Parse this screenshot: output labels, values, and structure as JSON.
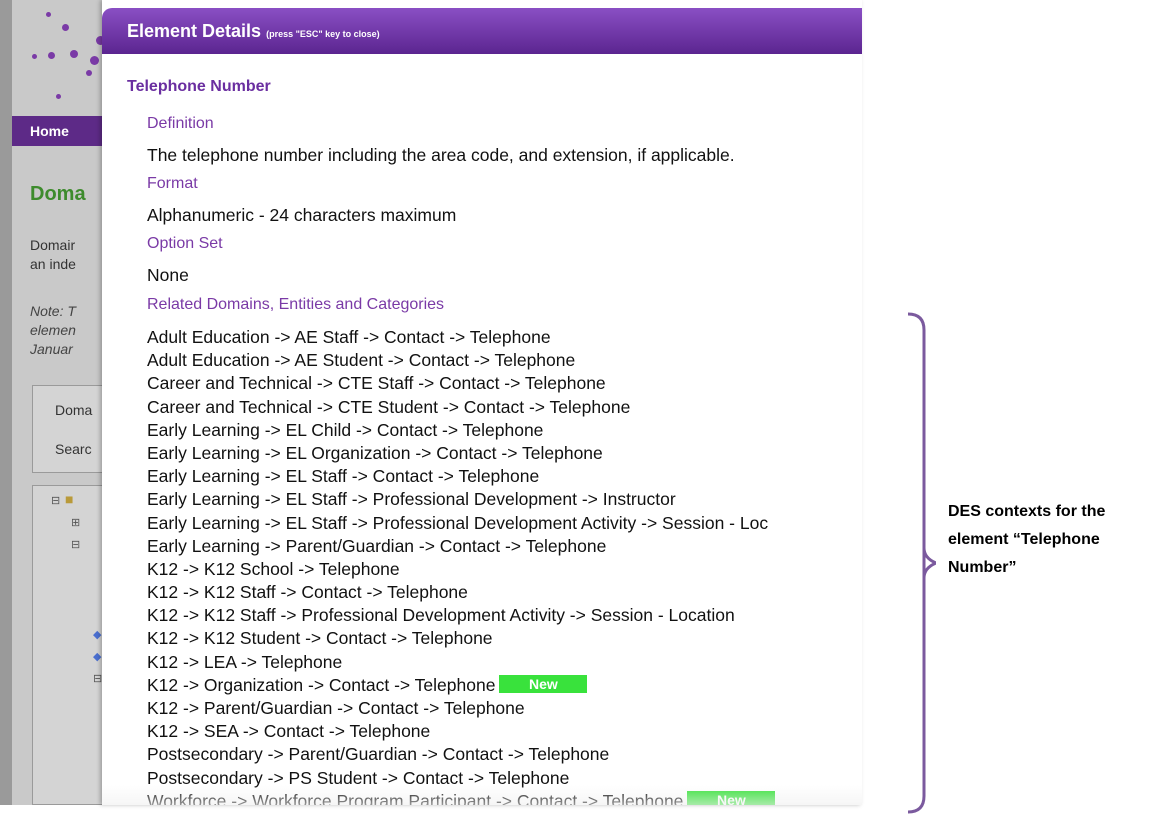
{
  "background": {
    "nav_home": "Home",
    "domain_title": "Doma",
    "text_line1": "Domair",
    "text_line2": "an inde",
    "note_line1": "Note: T",
    "note_line2": "elemen",
    "note_line3": "Januar",
    "box_line1": "Doma",
    "box_line2": "Searc"
  },
  "modal": {
    "title": "Element Details",
    "title_hint": "(press \"ESC\" key to close)",
    "element_name": "Telephone Number",
    "definition_label": "Definition",
    "definition_value": "The telephone number including the area code, and extension, if applicable.",
    "format_label": "Format",
    "format_value": "Alphanumeric - 24 characters maximum",
    "option_set_label": "Option Set",
    "option_set_value": "None",
    "related_label": "Related Domains, Entities and Categories",
    "related": [
      {
        "text": "Adult Education -> AE Staff -> Contact -> Telephone",
        "badge": ""
      },
      {
        "text": "Adult Education -> AE Student -> Contact -> Telephone",
        "badge": ""
      },
      {
        "text": "Career and Technical -> CTE Staff -> Contact -> Telephone",
        "badge": ""
      },
      {
        "text": "Career and Technical -> CTE Student -> Contact -> Telephone",
        "badge": ""
      },
      {
        "text": "Early Learning -> EL Child -> Contact -> Telephone",
        "badge": ""
      },
      {
        "text": "Early Learning -> EL Organization -> Contact -> Telephone",
        "badge": ""
      },
      {
        "text": "Early Learning -> EL Staff -> Contact -> Telephone",
        "badge": ""
      },
      {
        "text": "Early Learning -> EL Staff -> Professional Development -> Instructor",
        "badge": ""
      },
      {
        "text": "Early Learning -> EL Staff -> Professional Development Activity -> Session - Loc",
        "badge": ""
      },
      {
        "text": "Early Learning -> Parent/Guardian -> Contact -> Telephone",
        "badge": ""
      },
      {
        "text": "K12 -> K12 School -> Telephone",
        "badge": ""
      },
      {
        "text": "K12 -> K12 Staff -> Contact -> Telephone",
        "badge": ""
      },
      {
        "text": "K12 -> K12 Staff -> Professional Development Activity -> Session - Location",
        "badge": ""
      },
      {
        "text": "K12 -> K12 Student -> Contact -> Telephone",
        "badge": ""
      },
      {
        "text": "K12 -> LEA -> Telephone",
        "badge": ""
      },
      {
        "text": "K12 -> Organization -> Contact -> Telephone",
        "badge": "New"
      },
      {
        "text": "K12 -> Parent/Guardian -> Contact -> Telephone",
        "badge": ""
      },
      {
        "text": "K12 -> SEA -> Contact -> Telephone",
        "badge": ""
      },
      {
        "text": "Postsecondary -> Parent/Guardian -> Contact -> Telephone",
        "badge": ""
      },
      {
        "text": "Postsecondary -> PS Student -> Contact -> Telephone",
        "badge": ""
      },
      {
        "text": "Workforce -> Workforce Program Participant -> Contact -> Telephone",
        "badge": "New"
      }
    ]
  },
  "annotation": {
    "line1": "DES contexts for the",
    "line2": "element “Telephone",
    "line3": "Number”"
  },
  "colors": {
    "header_purple": "#5b2590",
    "label_purple": "#7a3aa6",
    "badge_green": "#39e23c",
    "bracket_purple": "#7b5a9e"
  }
}
